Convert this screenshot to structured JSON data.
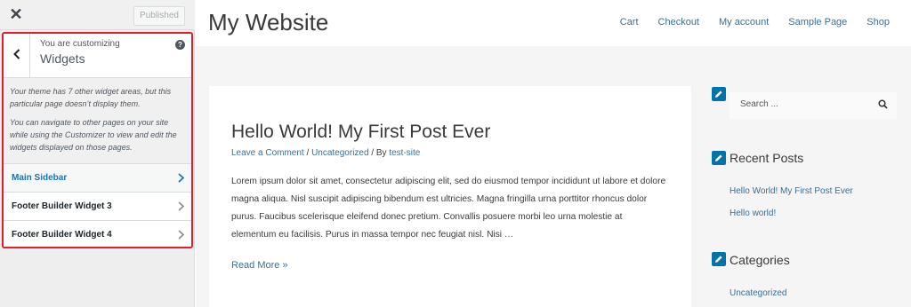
{
  "customizer": {
    "close_glyph": "✕",
    "publish_label": "Published",
    "customizing_label": "You are customizing",
    "section_title": "Widgets",
    "help_glyph": "?",
    "description": [
      "Your theme has 7 other widget areas, but this particular page doesn’t display them.",
      "You can navigate to other pages on your site while using the Customizer to view and edit the widgets displayed on those pages."
    ],
    "widget_areas": [
      {
        "label": "Main Sidebar",
        "active": true
      },
      {
        "label": "Footer Builder Widget 3",
        "active": false
      },
      {
        "label": "Footer Builder Widget 4",
        "active": false
      }
    ],
    "highlight_color": "#e11d2a",
    "accent_color": "#2271b1"
  },
  "site": {
    "title": "My Website",
    "nav": [
      "Cart",
      "Checkout",
      "My account",
      "Sample Page",
      "Shop"
    ],
    "post": {
      "title": "Hello World! My First Post Ever",
      "meta_comment": "Leave a Comment",
      "meta_sep1": " / ",
      "meta_category": "Uncategorized",
      "meta_sep2": " / By ",
      "meta_author": "test-site",
      "excerpt": "Lorem ipsum dolor sit amet, consectetur adipiscing elit, sed do eiusmod tempor incididunt ut labore et dolore magna aliqua. Nisl suscipit adipiscing bibendum est ultricies. Magna fringilla urna porttitor rhoncus dolor purus. Faucibus scelerisque eleifend donec pretium. Convallis posuere morbi leo urna molestie at elementum eu facilisis. Purus in massa tempor nec feugiat nisl. Nisi …",
      "read_more": "Read More »"
    },
    "sidebar": {
      "search_placeholder": "Search ...",
      "recent_posts_heading": "Recent Posts",
      "recent_posts": [
        "Hello World! My First Post Ever",
        "Hello world!"
      ],
      "categories_heading": "Categories",
      "categories": [
        "Uncategorized"
      ]
    },
    "link_color": "#3a6f95",
    "edit_icon_color": "#0073aa"
  }
}
